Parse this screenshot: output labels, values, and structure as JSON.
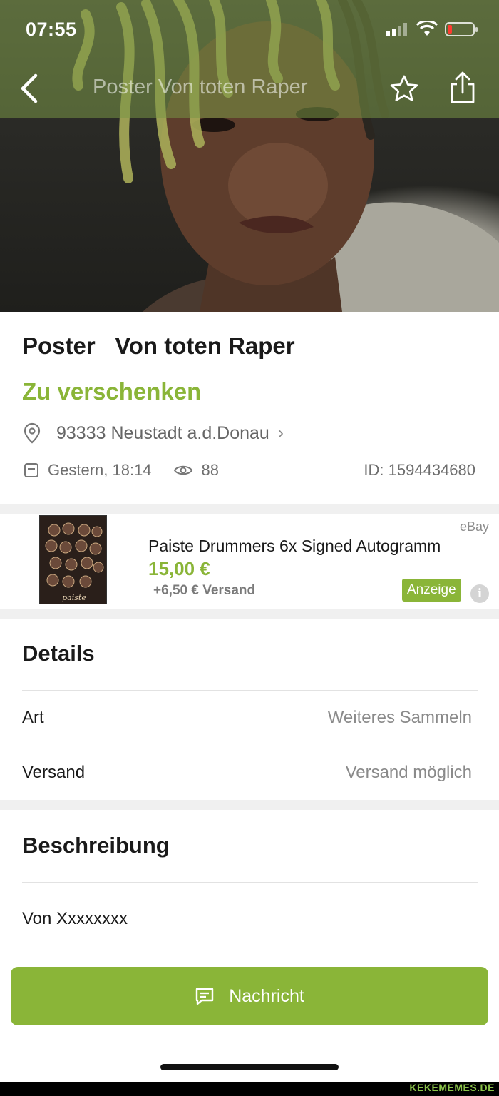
{
  "status": {
    "time": "07:55"
  },
  "nav": {
    "title": "Poster   Von toten Raper"
  },
  "listing": {
    "title": "Poster   Von toten Raper",
    "price_label": "Zu verschenken",
    "location": "93333 Neustadt a.d.Donau",
    "date": "Gestern, 18:14",
    "views": "88",
    "id": "ID: 1594434680"
  },
  "ad": {
    "source": "eBay",
    "title": "Paiste Drummers 6x Signed Autogramm",
    "price": "15,00 €",
    "shipping": "+6,50 € Versand",
    "badge": "Anzeige",
    "info_glyph": "i"
  },
  "details": {
    "heading": "Details",
    "rows": [
      {
        "label": "Art",
        "value": "Weiteres Sammeln"
      },
      {
        "label": "Versand",
        "value": "Versand möglich"
      }
    ]
  },
  "description": {
    "heading": "Beschreibung",
    "text": "Von Xxxxxxxx"
  },
  "action": {
    "label": "Nachricht"
  },
  "watermark": "KEKEMEMES.DE",
  "colors": {
    "accent": "#8ab538",
    "text": "#1a1a1a",
    "muted": "#8a8a8a"
  },
  "icons": [
    "back-chevron-icon",
    "star-icon",
    "share-icon",
    "location-pin-icon",
    "calendar-icon",
    "eye-icon",
    "chat-icon",
    "info-icon"
  ]
}
